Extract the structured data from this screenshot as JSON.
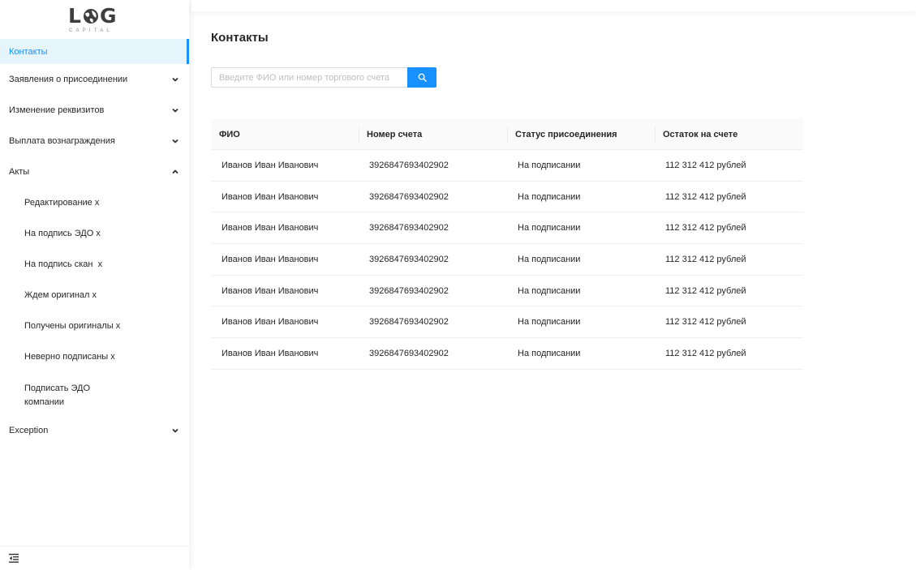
{
  "logo": {
    "main_left": "L",
    "main_right": "G",
    "sub": "CAPITAL"
  },
  "sidebar": {
    "items": [
      {
        "label": "Контакты",
        "active": true
      },
      {
        "label": "Заявления о присоединении",
        "expanded": false
      },
      {
        "label": "Изменение реквизитов",
        "expanded": false
      },
      {
        "label": "Выплата вознаграждения",
        "expanded": false
      },
      {
        "label": "Акты",
        "expanded": true
      },
      {
        "label": "Exception",
        "expanded": false
      }
    ],
    "acts_subitems": [
      "Редактирование x",
      "На подпись ЭДО x",
      "На подпись скан  x",
      "Ждем оригинал x",
      "Получены оригиналы x",
      "Неверно подписаны x",
      "Подписать ЭДО компании"
    ]
  },
  "page": {
    "title": "Контакты"
  },
  "search": {
    "placeholder": "Введите ФИО или номер торгового счета",
    "value": ""
  },
  "table": {
    "columns": [
      "ФИО",
      "Номер счета",
      "Статус присоединения",
      "Остаток на счете"
    ],
    "rows": [
      [
        "Иванов Иван Иванович",
        "3926847693402902",
        "На подписании",
        "112 312 412 рублей"
      ],
      [
        "Иванов Иван Иванович",
        "3926847693402902",
        "На подписании",
        "112 312 412 рублей"
      ],
      [
        "Иванов Иван Иванович",
        "3926847693402902",
        "На подписании",
        "112 312 412 рублей"
      ],
      [
        "Иванов Иван Иванович",
        "3926847693402902",
        "На подписании",
        "112 312 412 рублей"
      ],
      [
        "Иванов Иван Иванович",
        "3926847693402902",
        "На подписании",
        "112 312 412 рублей"
      ],
      [
        "Иванов Иван Иванович",
        "3926847693402902",
        "На подписании",
        "112 312 412 рублей"
      ],
      [
        "Иванов Иван Иванович",
        "3926847693402902",
        "На подписании",
        "112 312 412 рублей"
      ]
    ]
  },
  "colors": {
    "accent": "#1890ff",
    "active_bg": "#e6f4fc",
    "text": "#262626"
  },
  "icons": {
    "search": "search-icon",
    "chevron_down": "chevron-down-icon",
    "chevron_up": "chevron-up-icon",
    "collapse": "menu-collapse-icon"
  }
}
